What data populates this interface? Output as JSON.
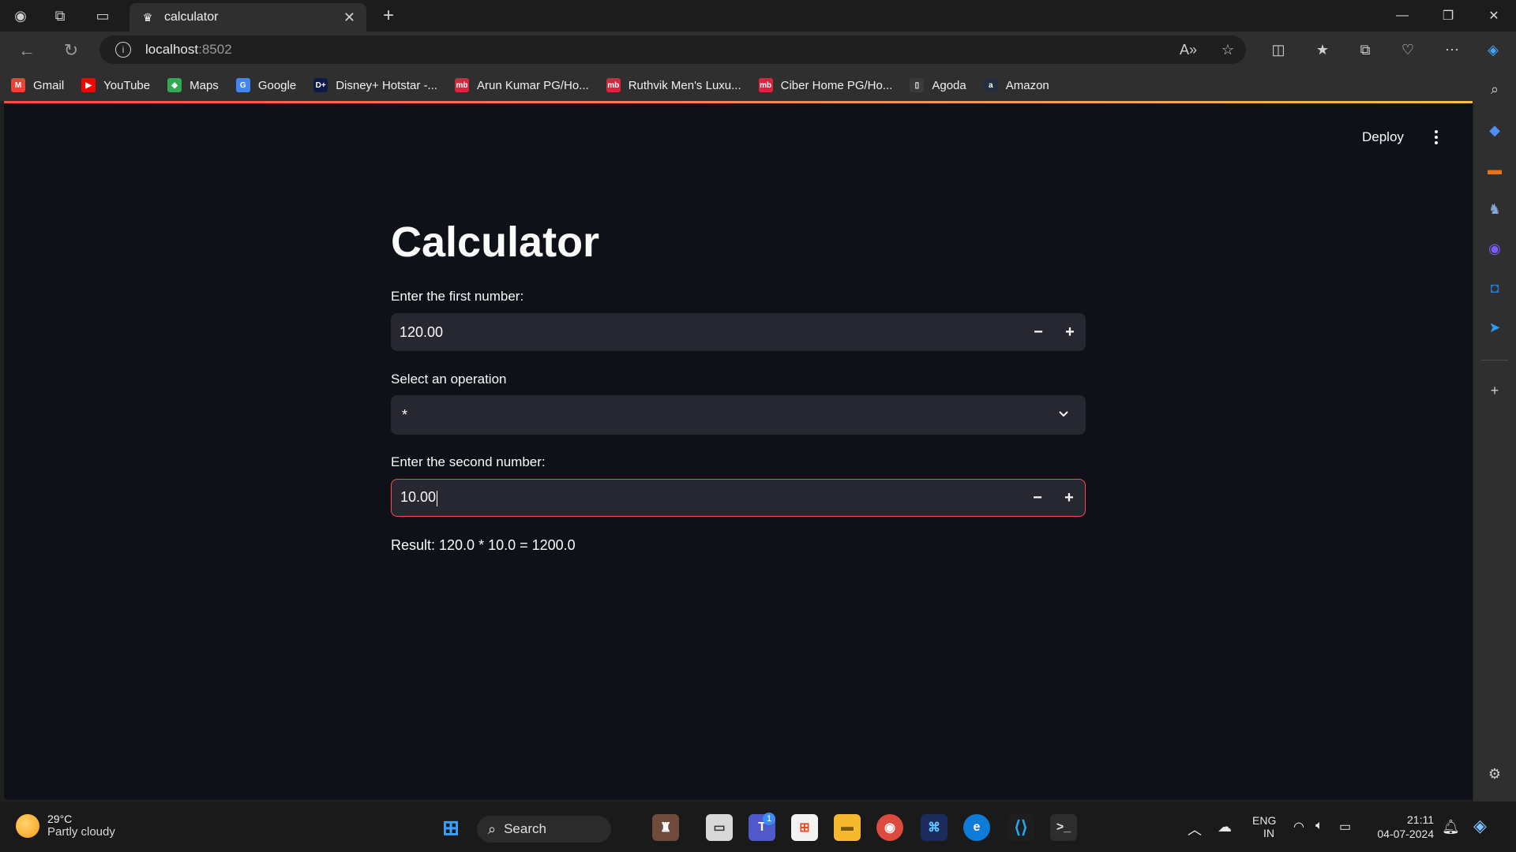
{
  "browser": {
    "tab_title": "calculator",
    "url_host": "localhost",
    "url_port": ":8502"
  },
  "bookmarks": [
    {
      "label": "Gmail",
      "icon": "gmail-icon",
      "color": "#ea4335",
      "glyph": "M"
    },
    {
      "label": "YouTube",
      "icon": "youtube-icon",
      "color": "#ff0000",
      "glyph": "▶"
    },
    {
      "label": "Maps",
      "icon": "maps-icon",
      "color": "#34a853",
      "glyph": "◆"
    },
    {
      "label": "Google",
      "icon": "google-icon",
      "color": "#4285f4",
      "glyph": "G"
    },
    {
      "label": "Disney+ Hotstar -...",
      "icon": "hotstar-icon",
      "color": "#0f1a4a",
      "glyph": "D+"
    },
    {
      "label": "Arun Kumar PG/Ho...",
      "icon": "magicbricks-icon",
      "color": "#d7263d",
      "glyph": "mb"
    },
    {
      "label": "Ruthvik Men's Luxu...",
      "icon": "magicbricks-icon",
      "color": "#d7263d",
      "glyph": "mb"
    },
    {
      "label": "Ciber Home PG/Ho...",
      "icon": "magicbricks-icon",
      "color": "#d7263d",
      "glyph": "mb"
    },
    {
      "label": "Agoda",
      "icon": "page-icon",
      "color": "#3a3a3a",
      "glyph": "▯"
    },
    {
      "label": "Amazon",
      "icon": "amazon-icon",
      "color": "#232f3e",
      "glyph": "a"
    }
  ],
  "app": {
    "deploy_label": "Deploy",
    "title": "Calculator",
    "first_label": "Enter the first number:",
    "first_value": "120.00",
    "operation_label": "Select an operation",
    "operation_value": "*",
    "second_label": "Enter the second number:",
    "second_value": "10.00",
    "minus": "−",
    "plus": "+",
    "result": "Result: 120.0 * 10.0 = 1200.0"
  },
  "taskbar": {
    "temperature": "29°C",
    "weather": "Partly cloudy",
    "search": "Search",
    "teams_badge": "1",
    "lang1": "ENG",
    "lang2": "IN",
    "time": "21:11",
    "date": "04-07-2024"
  },
  "colors": {
    "app_bg": "#0e1117",
    "input_bg": "#262730",
    "accent": "#ff4b4b"
  }
}
